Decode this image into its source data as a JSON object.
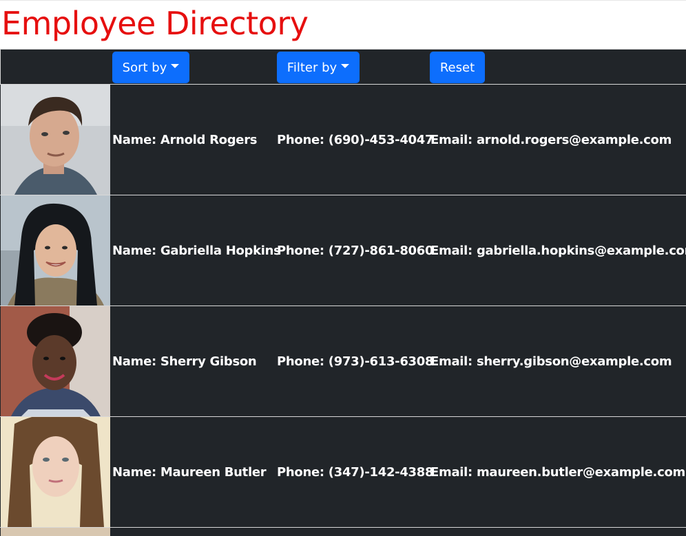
{
  "page": {
    "title": "Employee Directory"
  },
  "toolbar": {
    "sort_label": "Sort by",
    "filter_label": "Filter by",
    "reset_label": "Reset"
  },
  "labels": {
    "name": "Name:",
    "phone": "Phone:",
    "email": "Email:"
  },
  "employees": [
    {
      "name": "Arnold Rogers",
      "phone": "(690)-453-4047",
      "email": "arnold.rogers@example.com"
    },
    {
      "name": "Gabriella Hopkins",
      "phone": "(727)-861-8060",
      "email": "gabriella.hopkins@example.com"
    },
    {
      "name": "Sherry Gibson",
      "phone": "(973)-613-6308",
      "email": "sherry.gibson@example.com"
    },
    {
      "name": "Maureen Butler",
      "phone": "(347)-142-4388",
      "email": "maureen.butler@example.com"
    }
  ],
  "colors": {
    "title": "#e60f0f",
    "row_background": "#212529",
    "button": "#0d6efd"
  }
}
